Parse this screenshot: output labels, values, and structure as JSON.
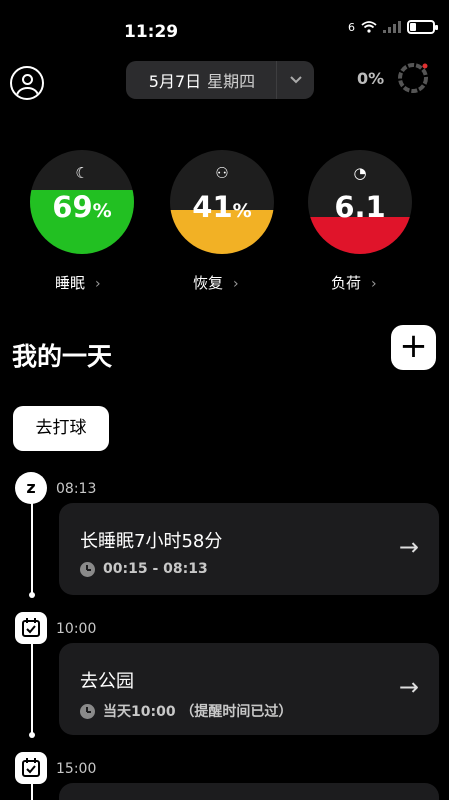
{
  "status_bar": {
    "time": "11:29",
    "signal": "6",
    "battery_level": 0.2
  },
  "header": {
    "date": "5月7日",
    "weekday": "星期四",
    "percent": "0%"
  },
  "gauges": [
    {
      "label": "睡眠",
      "value": "69",
      "unit": "%",
      "level": 0.62,
      "color": "#22c022",
      "icon": "sleep-moon-icon",
      "glyph": "☾"
    },
    {
      "label": "恢复",
      "value": "41",
      "unit": "%",
      "level": 0.42,
      "color": "#f2b125",
      "icon": "meditation-icon",
      "glyph": "⚇"
    },
    {
      "label": "负荷",
      "value": "6.1",
      "unit": "",
      "level": 0.36,
      "color": "#e0142a",
      "icon": "speedometer-icon",
      "glyph": "◔"
    }
  ],
  "my_day": {
    "title": "我的一天",
    "tag": "去打球",
    "arrow_glyph": "→",
    "chevron_glyph": "›"
  },
  "timeline": [
    {
      "time": "08:13",
      "icon": "sleep-icon",
      "title": "长睡眠7小时58分",
      "sub": "00:15 - 08:13"
    },
    {
      "time": "10:00",
      "icon": "calendar-icon",
      "title": "去公园",
      "sub": "当天10:00 （提醒时间已过）"
    },
    {
      "time": "15:00",
      "icon": "calendar-icon"
    }
  ]
}
